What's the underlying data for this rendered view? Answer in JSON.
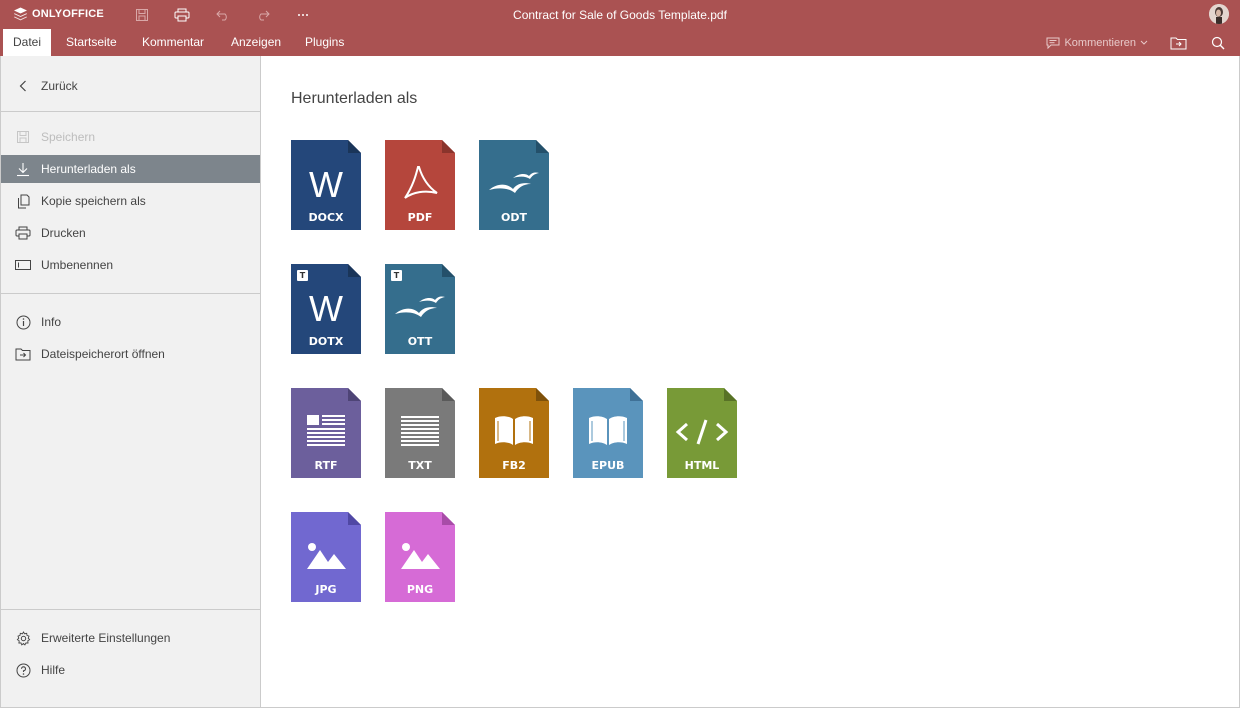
{
  "app": {
    "brand": "ONLYOFFICE",
    "doc_title": "Contract for Sale of Goods Template.pdf",
    "accent": "#aa5252"
  },
  "menu": {
    "tabs": [
      "Datei",
      "Startseite",
      "Kommentar",
      "Anzeigen",
      "Plugins"
    ],
    "comment_mode": "Kommentieren"
  },
  "sidebar": {
    "back": "Zurück",
    "items": [
      {
        "label": "Speichern",
        "icon": "save-icon",
        "state": "disabled"
      },
      {
        "label": "Herunterladen als",
        "icon": "download-icon",
        "state": "active"
      },
      {
        "label": "Kopie speichern als",
        "icon": "copy-icon",
        "state": "normal"
      },
      {
        "label": "Drucken",
        "icon": "print-icon",
        "state": "normal"
      },
      {
        "label": "Umbenennen",
        "icon": "rename-icon",
        "state": "normal"
      }
    ],
    "info": "Info",
    "open_location": "Dateispeicherort öffnen",
    "advanced": "Erweiterte Einstellungen",
    "help": "Hilfe"
  },
  "main": {
    "heading": "Herunterladen als",
    "formats": [
      {
        "label": "DOCX",
        "color": "#24477a",
        "glyph": "W"
      },
      {
        "label": "PDF",
        "color": "#b5463c",
        "glyph": "pdf"
      },
      {
        "label": "ODT",
        "color": "#356e8d",
        "glyph": "birds"
      },
      {
        "label": "DOTX",
        "color": "#24477a",
        "glyph": "W",
        "template": "T"
      },
      {
        "label": "OTT",
        "color": "#356e8d",
        "glyph": "birds",
        "template": "T"
      },
      {
        "label": "RTF",
        "color": "#6c5f9c",
        "glyph": "rtf"
      },
      {
        "label": "TXT",
        "color": "#7a7a7a",
        "glyph": "txt"
      },
      {
        "label": "FB2",
        "color": "#b1710e",
        "glyph": "book"
      },
      {
        "label": "EPUB",
        "color": "#5a94bc",
        "glyph": "book"
      },
      {
        "label": "HTML",
        "color": "#789a37",
        "glyph": "code"
      },
      {
        "label": "JPG",
        "color": "#7168d0",
        "glyph": "image"
      },
      {
        "label": "PNG",
        "color": "#d66bd6",
        "glyph": "image"
      }
    ]
  }
}
